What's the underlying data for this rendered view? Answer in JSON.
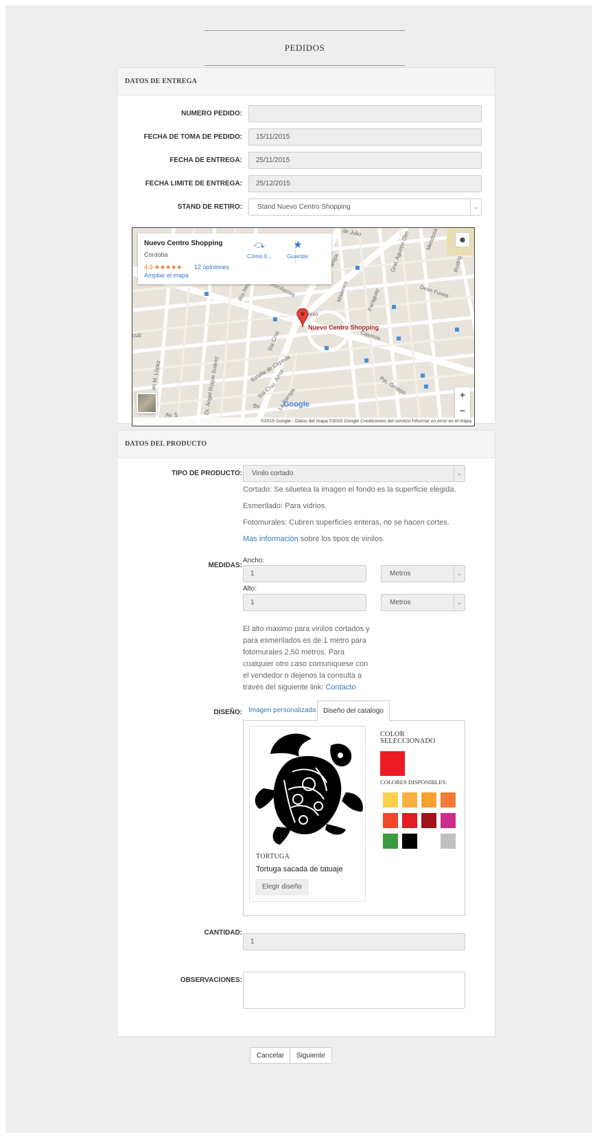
{
  "page_title": "PEDIDOS",
  "entrega": {
    "title": "DATOS DE ENTREGA",
    "numero_label": "NUMERO PEDIDO:",
    "numero_value": "",
    "toma_label": "FECHA DE TOMA DE PEDIDO:",
    "toma_value": "15/11/2015",
    "entrega_label": "FECHA DE ENTREGA:",
    "entrega_value": "25/11/2015",
    "limite_label": "FECHA LIMITE DE ENTREGA:",
    "limite_value": "25/12/2015",
    "stand_label": "STAND DE RETIRO:",
    "stand_value": "Stand Nuevo Centro Shopping"
  },
  "map": {
    "place_name": "Nuevo Centro Shopping",
    "city": "Córdoba",
    "rating": "4.3 ★★★★★",
    "reviews": "12 opiniones",
    "enlarge": "Ampliar el mapa",
    "directions": "Cómo ll...",
    "save": "Guardar",
    "pin_label": "Nuevo Centro Shopping",
    "google": "Google",
    "footer": "©2015 Google - Datos del mapa ©2015 Google    Condiciones del servicio    Informar un error en el mapa",
    "streets": {
      "julio": "de Julio",
      "mendoza": "Mendoza",
      "olmos": "Gral. Agustín Olm",
      "rodriguez": "Rodríg",
      "lapampa1": "La Pampa",
      "funes": "Deán Funes",
      "caseros1": "Caseros",
      "caseros2": "Caseros",
      "misiones": "Misiones",
      "paraguay": "Paraguay",
      "rionegro": "Río Neg",
      "recoq": "Recoq",
      "insomnio": "Insomnio",
      "cuti": "cuti",
      "stacruz1": "Sta Cruz",
      "cepeda": "Batalla de Cepeda",
      "pegroppo": "Pje. Groppo",
      "lopez": "an M. López",
      "suarez": "Dr. Ángel Roque Suárez",
      "stacruz2": "Sta Cruz",
      "arroz": "Arroz",
      "lapampa2": "La Pampa",
      "bv": "Bv.",
      "av": "Av. S"
    }
  },
  "producto": {
    "title": "DATOS DEL PRODUCTO",
    "tipo_label": "TIPO DE PRODUCTO:",
    "tipo_value": "Vinilo cortado",
    "help1": "Cortado: Se siluetea la imagen el fondo es la superficie elegida.",
    "help2": "Esmerilado: Para vidrios.",
    "help3": "Fotomurales: Cubren superficies enteras, no se hacen cortes.",
    "mas_info_link": "Mas información",
    "mas_info_rest": " sobre los tipos de vinilos.",
    "medidas_label": "MEDIDAS:",
    "ancho_label": "Ancho:",
    "ancho_value": "1",
    "ancho_unit": "Metros",
    "alto_label": "Alto:",
    "alto_value": "1",
    "alto_unit": "Metros",
    "note_lines": [
      "El alto maximo para vinilos cortados y",
      "para esmerilados es de 1 metro para",
      "fotomurales 2,50 metros. Para",
      "cualquier otro caso comuniquese con",
      "el vendedor o dejenos la consulta a",
      "través del siguiente link: "
    ],
    "contacto_link": "Contacto",
    "diseno_label": "DISEÑO:",
    "tab_personalizada": "Imagen personalizada",
    "tab_catalogo": "Diseño del catalogo",
    "design_title": "TORTUGA",
    "design_desc": "Tortuga sacada de tatuaje",
    "design_button": "Elegir diseño",
    "color_sel_label_1": "COLOR",
    "color_sel_label_2": "SELECCIONADO",
    "selected_color": "#ed1c24",
    "colores_label": "COLORES DISPONIBLES:",
    "swatches": [
      "#fcd14a",
      "#f9b040",
      "#f7a22e",
      "#f47937",
      "#f0472b",
      "#e31b23",
      "#a0131b",
      "#cd2d89",
      "#3a9a3e",
      "#000000",
      "#ffffff",
      "#c0c0c0"
    ],
    "cantidad_label": "CANTIDAD:",
    "cantidad_value": "1",
    "obs_label": "OBSERVACIONES:",
    "obs_value": ""
  },
  "buttons": {
    "cancel": "Cancelar",
    "next": "Siguiente"
  }
}
